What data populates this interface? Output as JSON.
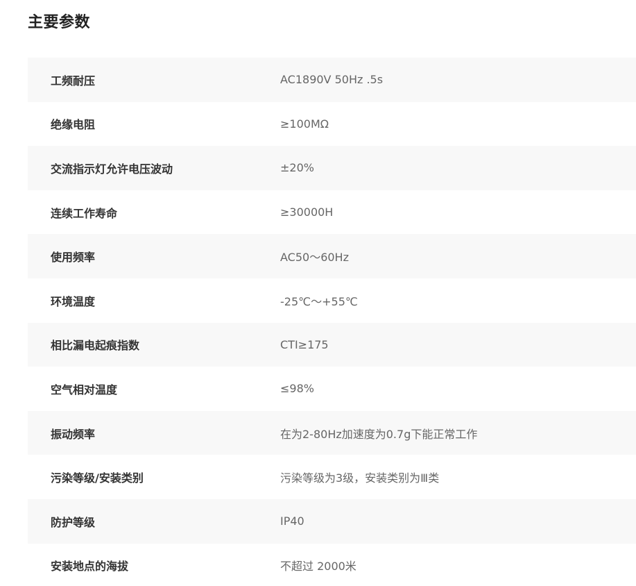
{
  "section": {
    "title": "主要参数"
  },
  "params": [
    {
      "label": "工频耐压",
      "value": "AC1890V 50Hz .5s"
    },
    {
      "label": "绝缘电阻",
      "value": "≥100MΩ"
    },
    {
      "label": "交流指示灯允许电压波动",
      "value": "±20%"
    },
    {
      "label": "连续工作寿命",
      "value": "≥30000H"
    },
    {
      "label": "使用频率",
      "value": "AC50～60Hz"
    },
    {
      "label": "环境温度",
      "value": "-25℃～+55℃"
    },
    {
      "label": "相比漏电起痕指数",
      "value": "CTI≥175"
    },
    {
      "label": "空气相对温度",
      "value": "≤98%"
    },
    {
      "label": "振动频率",
      "value": "在为2-80Hz加速度为0.7g下能正常工作"
    },
    {
      "label": "污染等级/安装类别",
      "value": "污染等级为3级，安装类别为Ⅲ类"
    },
    {
      "label": "防护等级",
      "value": "IP40"
    },
    {
      "label": "安装地点的海拔",
      "value": "不超过 2000米"
    }
  ]
}
